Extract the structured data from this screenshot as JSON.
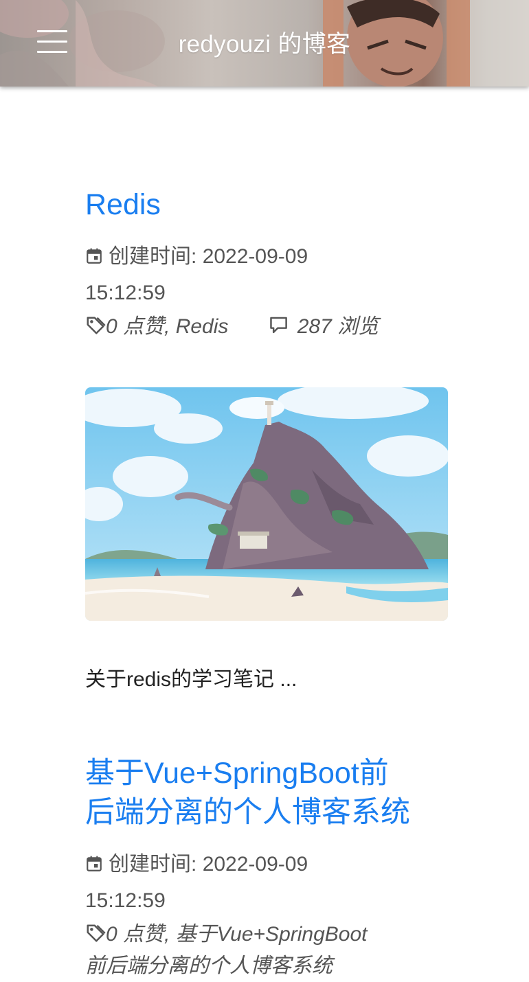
{
  "header": {
    "site_title": "redyouzi 的博客",
    "menu_icon": "hamburger-menu-icon"
  },
  "posts": [
    {
      "title": "Redis",
      "date_label": "创建时间:",
      "date_value": "2022-09-09",
      "time_value": "15:12:59",
      "likes": "0 点赞,",
      "tag": "Redis",
      "views": "287 浏览",
      "excerpt": "关于redis的学习笔记 ..."
    },
    {
      "title_line1": "基于Vue+SpringBoot前",
      "title_line2": "后端分离的个人博客系统",
      "date_label": "创建时间:",
      "date_value": "2022-09-09",
      "time_value": "15:12:59",
      "likes": "0 点赞,",
      "tag_line1": "基于Vue+SpringBoot",
      "tag_line2": "前后端分离的个人博客系统"
    }
  ],
  "colors": {
    "link": "#1a7ef0",
    "meta": "#555555",
    "text": "#222222"
  }
}
